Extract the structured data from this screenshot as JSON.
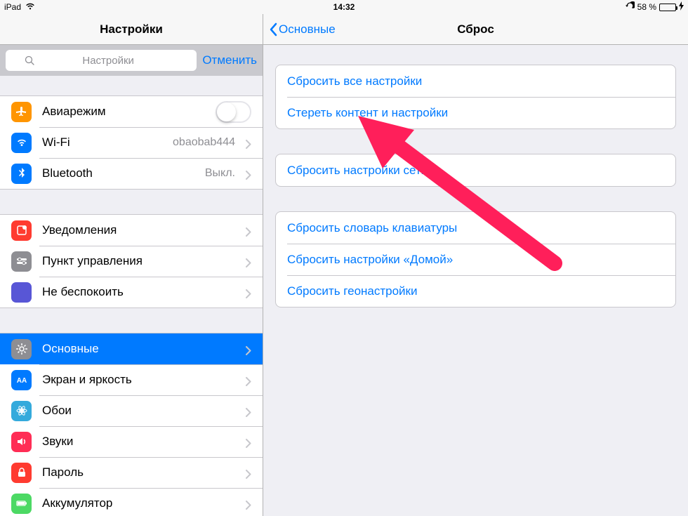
{
  "statusbar": {
    "device": "iPad",
    "time": "14:32",
    "battery_text": "58 %"
  },
  "sidebar": {
    "title": "Настройки",
    "search_placeholder": "Настройки",
    "cancel": "Отменить",
    "groups": [
      {
        "items": [
          {
            "id": "airplane",
            "icon": "airplane-icon",
            "color": "ic-orange",
            "label": "Авиарежим",
            "type": "switch",
            "switch_on": false
          },
          {
            "id": "wifi",
            "icon": "wifi-icon",
            "color": "ic-blue",
            "label": "Wi-Fi",
            "type": "value",
            "value": "obaobab444"
          },
          {
            "id": "bluetooth",
            "icon": "bluetooth-icon",
            "color": "ic-blue",
            "label": "Bluetooth",
            "type": "value",
            "value": "Выкл."
          }
        ]
      },
      {
        "items": [
          {
            "id": "notifications",
            "icon": "notifications-icon",
            "color": "ic-red",
            "label": "Уведомления",
            "type": "disclose"
          },
          {
            "id": "controlcenter",
            "icon": "controlcenter-icon",
            "color": "ic-gray",
            "label": "Пункт управления",
            "type": "disclose"
          },
          {
            "id": "dnd",
            "icon": "moon-icon",
            "color": "ic-purple",
            "label": "Не беспокоить",
            "type": "disclose"
          }
        ]
      },
      {
        "items": [
          {
            "id": "general",
            "icon": "gear-icon",
            "color": "ic-gray",
            "label": "Основные",
            "type": "disclose",
            "selected": true
          },
          {
            "id": "display",
            "icon": "display-icon",
            "color": "ic-blue",
            "label": "Экран и яркость",
            "type": "disclose"
          },
          {
            "id": "wallpaper",
            "icon": "wallpaper-icon",
            "color": "ic-atom",
            "label": "Обои",
            "type": "disclose"
          },
          {
            "id": "sounds",
            "icon": "sounds-icon",
            "color": "ic-red2",
            "label": "Звуки",
            "type": "disclose"
          },
          {
            "id": "passcode",
            "icon": "lock-icon",
            "color": "ic-red",
            "label": "Пароль",
            "type": "disclose"
          },
          {
            "id": "battery",
            "icon": "battery-icon",
            "color": "ic-green",
            "label": "Аккумулятор",
            "type": "disclose"
          }
        ]
      }
    ]
  },
  "detail": {
    "back": "Основные",
    "title": "Сброс",
    "groups": [
      [
        "Сбросить все настройки",
        "Стереть контент и настройки"
      ],
      [
        "Сбросить настройки сети"
      ],
      [
        "Сбросить словарь клавиатуры",
        "Сбросить настройки «Домой»",
        "Сбросить геонастройки"
      ]
    ]
  }
}
